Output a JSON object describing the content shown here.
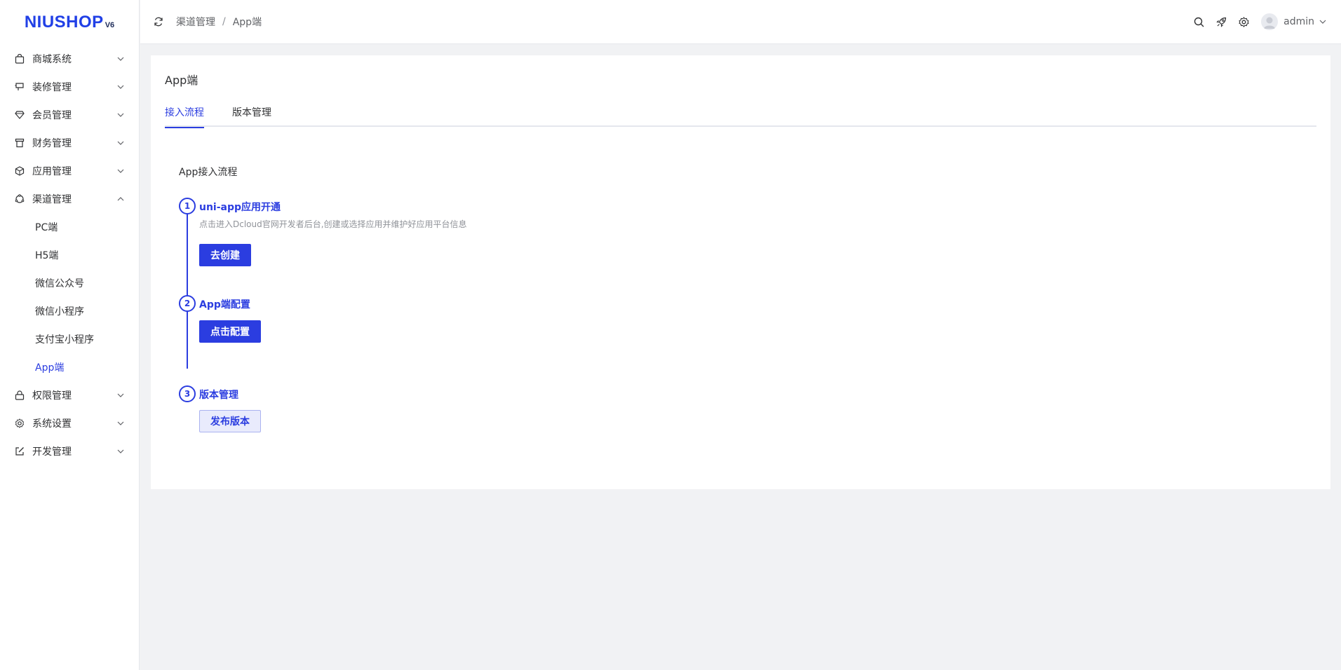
{
  "logo": {
    "text": "NIUSHOP",
    "version": "V6"
  },
  "sidebar": {
    "items": [
      {
        "label": "商城系统",
        "icon": "shopping-bag-icon"
      },
      {
        "label": "装修管理",
        "icon": "decoration-icon"
      },
      {
        "label": "会员管理",
        "icon": "diamond-icon"
      },
      {
        "label": "财务管理",
        "icon": "finance-icon"
      },
      {
        "label": "应用管理",
        "icon": "cube-icon"
      },
      {
        "label": "渠道管理",
        "icon": "channel-icon",
        "expanded": true
      },
      {
        "label": "权限管理",
        "icon": "lock-icon"
      },
      {
        "label": "系统设置",
        "icon": "gear-icon"
      },
      {
        "label": "开发管理",
        "icon": "edit-icon"
      }
    ],
    "submenu": [
      {
        "label": "PC端"
      },
      {
        "label": "H5端"
      },
      {
        "label": "微信公众号"
      },
      {
        "label": "微信小程序"
      },
      {
        "label": "支付宝小程序"
      },
      {
        "label": "App端",
        "active": true
      }
    ]
  },
  "header": {
    "breadcrumb": [
      "渠道管理",
      "App端"
    ],
    "breadcrumb_sep": "/",
    "icons": [
      "search-icon",
      "rocket-icon",
      "gear-icon"
    ],
    "username": "admin"
  },
  "main": {
    "title": "App端",
    "tabs": [
      {
        "label": "接入流程",
        "active": true
      },
      {
        "label": "版本管理"
      }
    ],
    "section_title": "App接入流程",
    "steps": [
      {
        "num": "1",
        "title": "uni-app应用开通",
        "desc": "点击进入Dcloud官网开发者后台,创建或选择应用并维护好应用平台信息",
        "button": "去创建"
      },
      {
        "num": "2",
        "title": "App端配置",
        "desc": "",
        "button": "点击配置"
      },
      {
        "num": "3",
        "title": "版本管理",
        "desc": "",
        "button": "发布版本"
      }
    ]
  },
  "colors": {
    "primary": "#2b3de0",
    "background": "#f1f2f4"
  }
}
